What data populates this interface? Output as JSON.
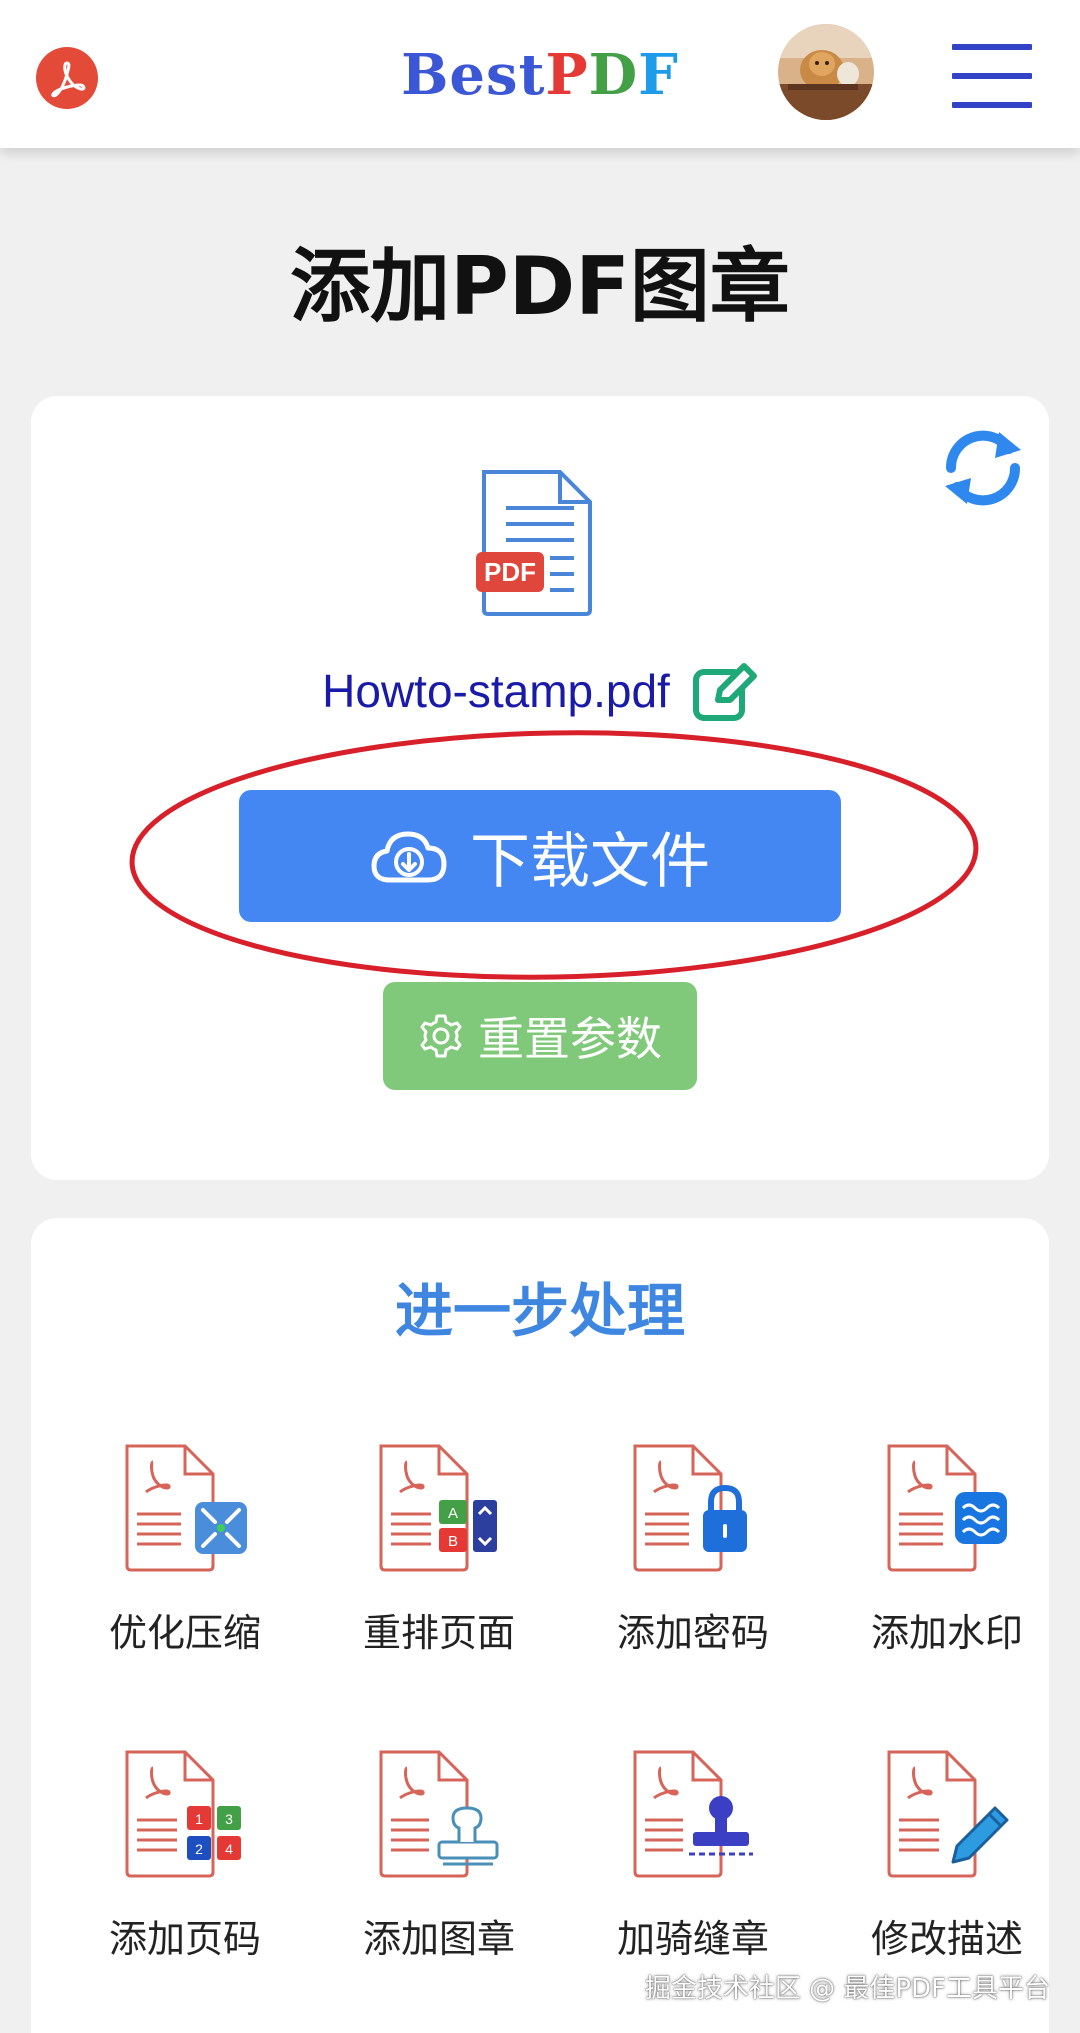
{
  "header": {
    "brand_prefix": "Best",
    "brand_p": "P",
    "brand_d": "D",
    "brand_f": "F",
    "logo_icon": "acrobat-logo-icon",
    "menu_icon": "hamburger-menu-icon"
  },
  "page": {
    "title": "添加PDF图章"
  },
  "result": {
    "file_badge": "PDF",
    "filename": "Howto-stamp.pdf",
    "download_label": "下载文件",
    "reset_label": "重置参数"
  },
  "further": {
    "title": "进一步处理",
    "tools": [
      {
        "label": "优化压缩",
        "icon": "compress-icon"
      },
      {
        "label": "重排页面",
        "icon": "reorder-icon"
      },
      {
        "label": "添加密码",
        "icon": "lock-icon"
      },
      {
        "label": "添加水印",
        "icon": "watermark-icon"
      },
      {
        "label": "添加页码",
        "icon": "page-number-icon"
      },
      {
        "label": "添加图章",
        "icon": "stamp-icon"
      },
      {
        "label": "加骑缝章",
        "icon": "seam-stamp-icon"
      },
      {
        "label": "修改描述",
        "icon": "edit-description-icon"
      }
    ]
  },
  "watermark": "掘金技术社区 @ 最佳PDF工具平台",
  "colors": {
    "brand_blue": "#3b57d6",
    "download_button": "#4487f2",
    "reset_button": "#80c97a",
    "section_title": "#3f86e0",
    "highlight_circle": "#d8202a"
  }
}
